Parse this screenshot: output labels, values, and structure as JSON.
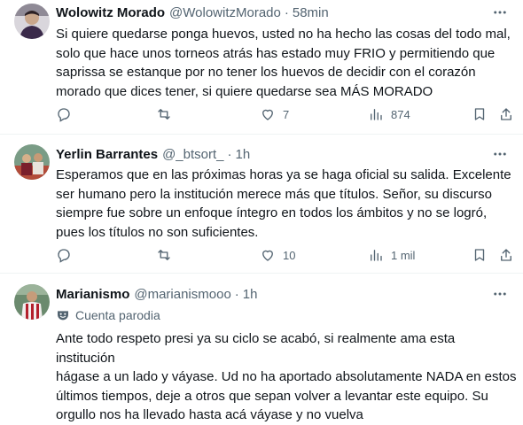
{
  "tweets": [
    {
      "name": "Wolowitz Morado",
      "handle": "@WolowitzMorado",
      "separator": "·",
      "time": "58min",
      "text": "Si quiere quedarse ponga huevos, usted no ha hecho las cosas del todo mal,\nsolo que hace unos torneos atrás has estado muy FRIO y permitiendo que\nsaprissa se estanque por no tener los huevos de decidir con el corazón\nmorado que dices tener, si quiere quedarse sea MÁS MORADO",
      "reply_count": "",
      "retweet_count": "",
      "like_count": "7",
      "view_count": "874"
    },
    {
      "name": "Yerlin Barrantes",
      "handle": "@_btsort_",
      "separator": "·",
      "time": "1h",
      "text": "Esperamos que en las próximas horas ya se haga oficial su salida. Excelente\nser humano pero la institución merece más que títulos. Señor, su discurso\nsiempre fue sobre un enfoque íntegro en todos los ámbitos y no se logró,\npues los títulos no son suficientes.",
      "reply_count": "",
      "retweet_count": "",
      "like_count": "10",
      "view_count": "1 mil"
    },
    {
      "name": "Marianismo",
      "handle": "@marianismooo",
      "separator": "·",
      "time": "1h",
      "parody_label": "Cuenta parodia",
      "text": "Ante todo respeto presi ya su ciclo se acabó, si realmente ama esta institución\nhágase a un lado y váyase. Ud no ha aportado absolutamente NADA en estos\núltimos tiempos, deje a otros que sepan volver a levantar este equipo. Su\norgullo nos ha llevado hasta acá váyase y no vuelva"
    }
  ],
  "icons": {
    "more": "more-icon",
    "reply": "reply-icon",
    "retweet": "retweet-icon",
    "like": "heart-icon",
    "views": "views-icon",
    "bookmark": "bookmark-icon",
    "share": "share-icon",
    "parody": "parody-mask-icon"
  },
  "colors": {
    "text": "#0f1419",
    "secondary": "#536471",
    "divider": "#eff3f4"
  }
}
